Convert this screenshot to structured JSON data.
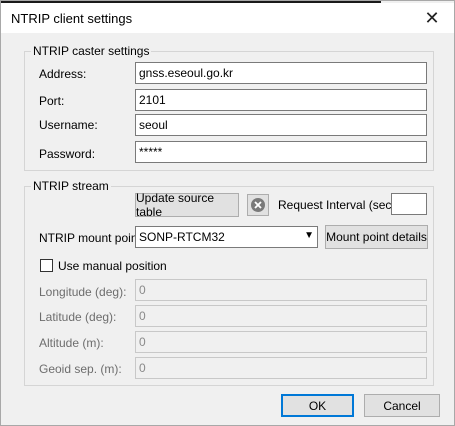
{
  "window": {
    "title": "NTRIP client settings"
  },
  "caster": {
    "legend": "NTRIP caster settings",
    "address_label": "Address:",
    "address_value": "gnss.eseoul.go.kr",
    "port_label": "Port:",
    "port_value": "2101",
    "username_label": "Username:",
    "username_value": "seoul",
    "password_label": "Password:",
    "password_value": "*****"
  },
  "stream": {
    "legend": "NTRIP stream",
    "update_source_label": "Update source table",
    "request_interval_label": "Request Interval (sec)",
    "request_interval_value": "",
    "mount_point_label": "NTRIP mount point:",
    "mount_point_value": "SONP-RTCM32",
    "mount_point_details_label": "Mount point details",
    "manual_position_label": "Use manual position",
    "manual_position_checked": false,
    "longitude_label": "Longitude (deg):",
    "longitude_value": "0",
    "latitude_label": "Latitude (deg):",
    "latitude_value": "0",
    "altitude_label": "Altitude (m):",
    "altitude_value": "0",
    "geoid_label": "Geoid sep. (m):",
    "geoid_value": "0"
  },
  "footer": {
    "ok_label": "OK",
    "cancel_label": "Cancel"
  }
}
